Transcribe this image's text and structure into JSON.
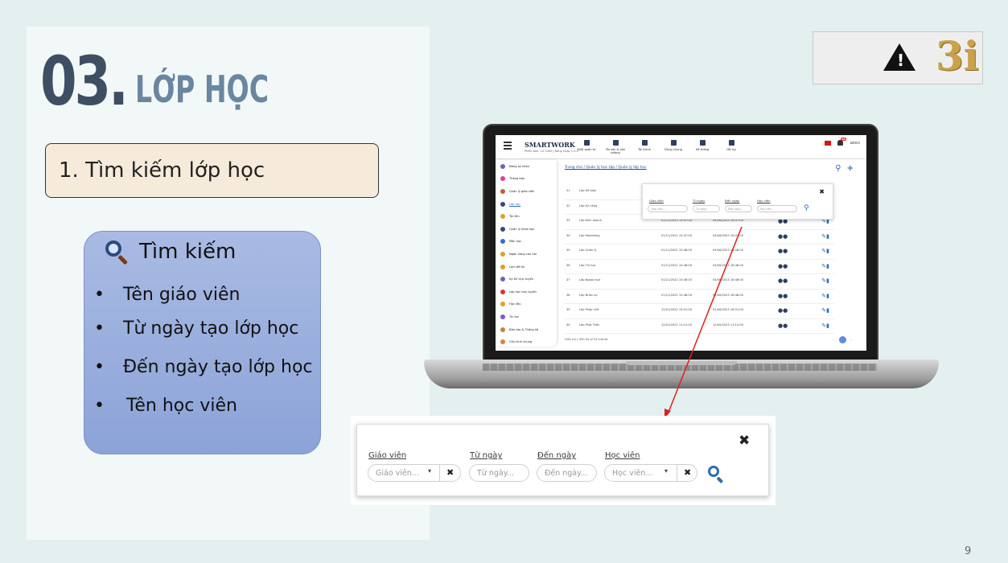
{
  "slide": {
    "number_label": "03.",
    "title_word": "LỚP HỌC",
    "subtitle": "1. Tìm kiếm lớp học",
    "page_number": "9"
  },
  "search_card": {
    "heading": "Tìm kiếm",
    "icon": "magnifier-icon",
    "criteria": [
      "Tên giáo viên",
      "Từ ngày tạo lớp học",
      "Đến ngày tạo lớp học",
      "Tên học viên"
    ]
  },
  "logo": {
    "icon": "warning-icon",
    "brand": "3i"
  },
  "app_screen": {
    "brand": "SMARTWORK",
    "brand_sub": "Phiên bản: 10.1983 | Đăng nhập 1.0.0",
    "nav_items": [
      "Khối quản trị",
      "Tài sản & văn phòng",
      "Tài chính",
      "Dùng chung",
      "Hệ thống",
      "Hỗ trợ"
    ],
    "user": "admin",
    "notification_count": "99",
    "breadcrumb": "Trang chủ / Quản lý học tập / Quản lý lớp học",
    "sidebar_items": [
      "Đăng ký khóa",
      "Thông báo",
      "Quản lý giáo viên",
      "Lớp học",
      "Tài liệu",
      "Quản lý khóa học",
      "Môn học",
      "Ngân hàng câu hỏi",
      "Làm đề thi",
      "Kỳ thi trực tuyến",
      "Lớp học trực tuyến",
      "Học liệu",
      "Tin tức",
      "Báo cáo & Thống kê",
      "Cấu hình chung"
    ],
    "table_rows": [
      {
        "no": "31",
        "name": "Lớp Kế toán",
        "created": "",
        "end": ""
      },
      {
        "no": "32",
        "name": "Lớp Kỹ năng",
        "created": "",
        "end": ""
      },
      {
        "no": "33",
        "name": "Lớp Kinh doanh",
        "created": "01/11/2022 15:47:00",
        "end": "04/06/2023 16:47:00"
      },
      {
        "no": "34",
        "name": "Lớp Marketing",
        "created": "01/11/2022 15:47:00",
        "end": "04/06/2023 16:47:00"
      },
      {
        "no": "35",
        "name": "Lớp Quản lý",
        "created": "01/11/2022 15:48:00",
        "end": "04/06/2023 16:48:00"
      },
      {
        "no": "36",
        "name": "Lớp Tin học",
        "created": "01/11/2022 15:48:00",
        "end": "04/06/2023 16:48:00"
      },
      {
        "no": "37",
        "name": "Lớp Ngoại ngữ",
        "created": "01/11/2022 15:48:00",
        "end": "04/06/2023 16:48:00"
      },
      {
        "no": "38",
        "name": "Lớp Nhân sự",
        "created": "01/11/2022 15:48:00",
        "end": "04/06/2023 16:48:00"
      },
      {
        "no": "39",
        "name": "Lớp Pháp chế",
        "created": "12/01/2022 15:51:00",
        "end": "01/06/2023 16:51:00"
      },
      {
        "no": "40",
        "name": "Lớp Phát Triển",
        "created": "12/01/2022 11:12:00",
        "end": "12/05/2023 11:12:00"
      }
    ],
    "pager": "Hiển thị 1 đến 50 of 54 entries"
  },
  "filter_panel": {
    "teacher_label": "Giáo viên",
    "teacher_placeholder": "Giáo viên...",
    "from_label": "Từ ngày",
    "from_placeholder": "Từ ngày...",
    "to_label": "Đến ngày",
    "to_placeholder": "Đến ngày...",
    "student_label": "Học viên",
    "student_placeholder": "Học viên...",
    "close_symbol": "✖",
    "clear_symbol": "✖",
    "caret_symbol": "▾"
  },
  "colors": {
    "title_dark": "#3e4f64",
    "title_light": "#6a86a0",
    "accent_blue": "#2a6db5",
    "connector_red": "#e02020"
  }
}
